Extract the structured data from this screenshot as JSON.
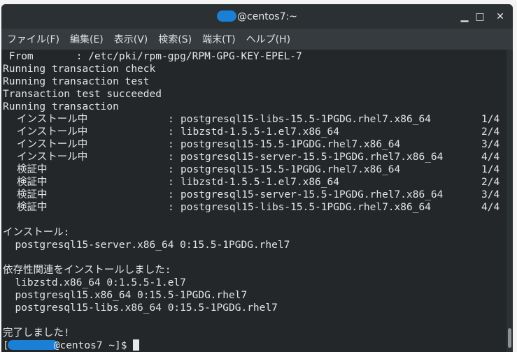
{
  "window": {
    "title": "@centos7:~",
    "minimize": "▁",
    "maximize": "□",
    "close": "✕"
  },
  "menu": [
    "ファイル(F)",
    "編集(E)",
    "表示(V)",
    "検索(S)",
    "端末(T)",
    "ヘルプ(H)"
  ],
  "terminal": {
    "pre": [
      " From       : /etc/pki/rpm-gpg/RPM-GPG-KEY-EPEL-7",
      "Running transaction check",
      "Running transaction test",
      "Transaction test succeeded",
      "Running transaction"
    ],
    "steps": [
      {
        "status": "インストール中",
        "pkg": "postgresql15-libs-15.5-1PGDG.rhel7.x86_64",
        "count": "1/4"
      },
      {
        "status": "インストール中",
        "pkg": "libzstd-1.5.5-1.el7.x86_64",
        "count": "2/4"
      },
      {
        "status": "インストール中",
        "pkg": "postgresql15-15.5-1PGDG.rhel7.x86_64",
        "count": "3/4"
      },
      {
        "status": "インストール中",
        "pkg": "postgresql15-server-15.5-1PGDG.rhel7.x86_64",
        "count": "4/4"
      },
      {
        "status": "検証中",
        "pkg": "postgresql15-15.5-1PGDG.rhel7.x86_64",
        "count": "1/4"
      },
      {
        "status": "検証中",
        "pkg": "libzstd-1.5.5-1.el7.x86_64",
        "count": "2/4"
      },
      {
        "status": "検証中",
        "pkg": "postgresql15-server-15.5-1PGDG.rhel7.x86_64",
        "count": "3/4"
      },
      {
        "status": "検証中",
        "pkg": "postgresql15-libs-15.5-1PGDG.rhel7.x86_64",
        "count": "4/4"
      }
    ],
    "colon": ":",
    "installed_header": "インストール:",
    "installed": [
      "  postgresql15-server.x86_64 0:15.5-1PGDG.rhel7"
    ],
    "deps_header": "依存性関連をインストールしました:",
    "deps": [
      "  libzstd.x86_64 0:1.5.5-1.el7",
      "  postgresql15.x86_64 0:15.5-1PGDG.rhel7",
      "  postgresql15-libs.x86_64 0:15.5-1PGDG.rhel7"
    ],
    "done": "完了しました!",
    "prompt_open": "[",
    "prompt": "@centos7 ~]$ "
  }
}
